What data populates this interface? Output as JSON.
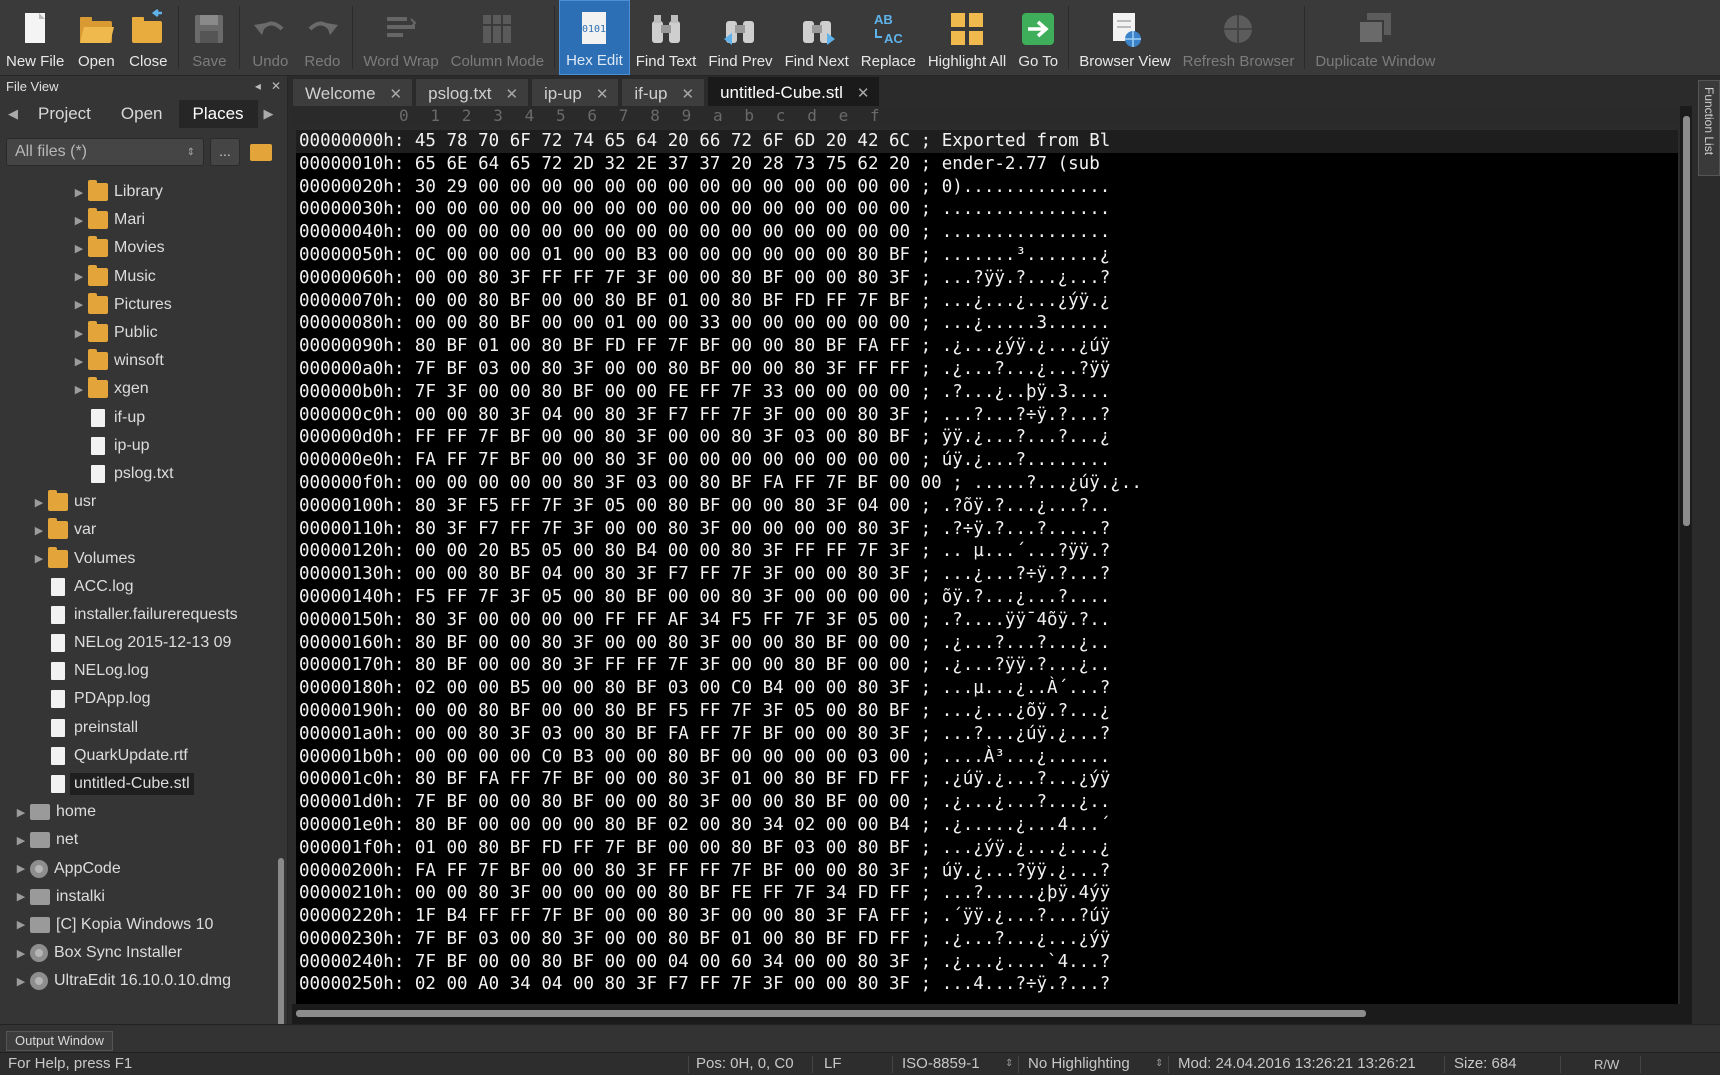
{
  "toolbar": {
    "buttons": [
      {
        "label": "New File",
        "icon": "new-file-icon",
        "enabled": true
      },
      {
        "label": "Open",
        "icon": "open-folder-icon",
        "enabled": true
      },
      {
        "label": "Close",
        "icon": "close-folder-icon",
        "enabled": true
      },
      {
        "label": "Save",
        "icon": "save-icon",
        "enabled": false
      },
      {
        "label": "Undo",
        "icon": "undo-icon",
        "enabled": false
      },
      {
        "label": "Redo",
        "icon": "redo-icon",
        "enabled": false
      },
      {
        "label": "Word Wrap",
        "icon": "word-wrap-icon",
        "enabled": false
      },
      {
        "label": "Column Mode",
        "icon": "column-mode-icon",
        "enabled": false
      },
      {
        "label": "Hex Edit",
        "icon": "hex-edit-icon",
        "enabled": true,
        "active": true,
        "icon_text": "0101"
      },
      {
        "label": "Find Text",
        "icon": "binoculars-icon",
        "enabled": true
      },
      {
        "label": "Find Prev",
        "icon": "find-prev-icon",
        "enabled": true
      },
      {
        "label": "Find Next",
        "icon": "find-next-icon",
        "enabled": true
      },
      {
        "label": "Replace",
        "icon": "replace-icon",
        "enabled": true,
        "icon_text_top": "AB",
        "icon_text_bottom": "AC"
      },
      {
        "label": "Highlight All",
        "icon": "highlight-all-icon",
        "enabled": true
      },
      {
        "label": "Go To",
        "icon": "go-to-icon",
        "enabled": true
      },
      {
        "label": "Browser View",
        "icon": "browser-view-icon",
        "enabled": true
      },
      {
        "label": "Refresh Browser",
        "icon": "refresh-browser-icon",
        "enabled": false
      },
      {
        "label": "Duplicate Window",
        "icon": "duplicate-window-icon",
        "enabled": false
      }
    ]
  },
  "file_view": {
    "title": "File View",
    "tabs": [
      "Project",
      "Open",
      "Places"
    ],
    "selected_tab": "Places",
    "filter": "All files (*)",
    "more_label": "...",
    "tree": [
      {
        "label": "Library",
        "type": "folder",
        "depth": 2,
        "expandable": true
      },
      {
        "label": "Mari",
        "type": "folder",
        "depth": 2,
        "expandable": true
      },
      {
        "label": "Movies",
        "type": "folder",
        "depth": 2,
        "expandable": true
      },
      {
        "label": "Music",
        "type": "folder",
        "depth": 2,
        "expandable": true
      },
      {
        "label": "Pictures",
        "type": "folder",
        "depth": 2,
        "expandable": true
      },
      {
        "label": "Public",
        "type": "folder",
        "depth": 2,
        "expandable": true
      },
      {
        "label": "winsoft",
        "type": "folder",
        "depth": 2,
        "expandable": true
      },
      {
        "label": "xgen",
        "type": "folder",
        "depth": 2,
        "expandable": true
      },
      {
        "label": "if-up",
        "type": "file",
        "depth": 2,
        "expandable": false
      },
      {
        "label": "ip-up",
        "type": "file",
        "depth": 2,
        "expandable": false
      },
      {
        "label": "pslog.txt",
        "type": "file",
        "depth": 2,
        "expandable": false
      },
      {
        "label": "usr",
        "type": "folder",
        "depth": 1,
        "expandable": true
      },
      {
        "label": "var",
        "type": "folder",
        "depth": 1,
        "expandable": true
      },
      {
        "label": "Volumes",
        "type": "folder",
        "depth": 1,
        "expandable": true
      },
      {
        "label": "ACC.log",
        "type": "file",
        "depth": 1,
        "expandable": false
      },
      {
        "label": "installer.failurerequests",
        "type": "file",
        "depth": 1,
        "expandable": false
      },
      {
        "label": "NELog 2015-12-13 09",
        "type": "file",
        "depth": 1,
        "expandable": false
      },
      {
        "label": "NELog.log",
        "type": "file",
        "depth": 1,
        "expandable": false
      },
      {
        "label": "PDApp.log",
        "type": "file",
        "depth": 1,
        "expandable": false
      },
      {
        "label": "preinstall",
        "type": "file",
        "depth": 1,
        "expandable": false
      },
      {
        "label": "QuarkUpdate.rtf",
        "type": "file",
        "depth": 1,
        "expandable": false
      },
      {
        "label": "untitled-Cube.stl",
        "type": "file",
        "depth": 1,
        "expandable": false,
        "selected": true
      },
      {
        "label": "home",
        "type": "drive",
        "depth": 0,
        "expandable": true
      },
      {
        "label": "net",
        "type": "drive",
        "depth": 0,
        "expandable": true
      },
      {
        "label": "AppCode",
        "type": "disc",
        "depth": 0,
        "expandable": true
      },
      {
        "label": "instalki",
        "type": "drive",
        "depth": 0,
        "expandable": true
      },
      {
        "label": "[C] Kopia Windows 10",
        "type": "drive",
        "depth": 0,
        "expandable": true
      },
      {
        "label": "Box Sync Installer",
        "type": "disc",
        "depth": 0,
        "expandable": true
      },
      {
        "label": "UltraEdit 16.10.0.10.dmg",
        "type": "disc",
        "depth": 0,
        "expandable": true
      }
    ]
  },
  "editor": {
    "tabs": [
      {
        "label": "Welcome",
        "active": false
      },
      {
        "label": "pslog.txt",
        "active": false
      },
      {
        "label": "ip-up",
        "active": false
      },
      {
        "label": "if-up",
        "active": false
      },
      {
        "label": "untitled-Cube.stl",
        "active": true
      }
    ],
    "column_headers": [
      "0",
      "1",
      "2",
      "3",
      "4",
      "5",
      "6",
      "7",
      "8",
      "9",
      "a",
      "b",
      "c",
      "d",
      "e",
      "f"
    ],
    "hex_rows": [
      "00000000h: 45 78 70 6F 72 74 65 64 20 66 72 6F 6D 20 42 6C ; Exported from Bl",
      "00000010h: 65 6E 64 65 72 2D 32 2E 37 37 20 28 73 75 62 20 ; ender-2.77 (sub ",
      "00000020h: 30 29 00 00 00 00 00 00 00 00 00 00 00 00 00 00 ; 0)..............",
      "00000030h: 00 00 00 00 00 00 00 00 00 00 00 00 00 00 00 00 ; ................",
      "00000040h: 00 00 00 00 00 00 00 00 00 00 00 00 00 00 00 00 ; ................",
      "00000050h: 0C 00 00 00 01 00 00 B3 00 00 00 00 00 00 80 BF ; .......³.......¿",
      "00000060h: 00 00 80 3F FF FF 7F 3F 00 00 80 BF 00 00 80 3F ; ...?ÿÿ.?...¿...?",
      "00000070h: 00 00 80 BF 00 00 80 BF 01 00 80 BF FD FF 7F BF ; ...¿...¿...¿ýÿ.¿",
      "00000080h: 00 00 80 BF 00 00 01 00 00 33 00 00 00 00 00 00 ; ...¿.....3......",
      "00000090h: 80 BF 01 00 80 BF FD FF 7F BF 00 00 80 BF FA FF ; .¿...¿ýÿ.¿...¿úÿ",
      "000000a0h: 7F BF 03 00 80 3F 00 00 80 BF 00 00 80 3F FF FF ; .¿...?...¿...?ÿÿ",
      "000000b0h: 7F 3F 00 00 80 BF 00 00 FE FF 7F 33 00 00 00 00 ; .?...¿..þÿ.3....",
      "000000c0h: 00 00 80 3F 04 00 80 3F F7 FF 7F 3F 00 00 80 3F ; ...?...?÷ÿ.?...?",
      "000000d0h: FF FF 7F BF 00 00 80 3F 00 00 80 3F 03 00 80 BF ; ÿÿ.¿...?...?...¿",
      "000000e0h: FA FF 7F BF 00 00 80 3F 00 00 00 00 00 00 00 00 ; úÿ.¿...?........",
      "000000f0h: 00 00 00 00 00 80 3F 03 00 80 BF FA FF 7F BF 00 00 ; .....?...¿úÿ.¿..",
      "00000100h: 80 3F F5 FF 7F 3F 05 00 80 BF 00 00 80 3F 04 00 ; .?õÿ.?...¿...?..",
      "00000110h: 80 3F F7 FF 7F 3F 00 00 80 3F 00 00 00 00 80 3F ; .?÷ÿ.?...?.....?",
      "00000120h: 00 00 20 B5 05 00 80 B4 00 00 80 3F FF FF 7F 3F ; .. µ...´...?ÿÿ.?",
      "00000130h: 00 00 80 BF 04 00 80 3F F7 FF 7F 3F 00 00 80 3F ; ...¿...?÷ÿ.?...?",
      "00000140h: F5 FF 7F 3F 05 00 80 BF 00 00 80 3F 00 00 00 00 ; õÿ.?...¿...?....",
      "00000150h: 80 3F 00 00 00 00 FF FF AF 34 F5 FF 7F 3F 05 00 ; .?....ÿÿ¯4õÿ.?..",
      "00000160h: 80 BF 00 00 80 3F 00 00 80 3F 00 00 80 BF 00 00 ; .¿...?...?...¿..",
      "00000170h: 80 BF 00 00 80 3F FF FF 7F 3F 00 00 80 BF 00 00 ; .¿...?ÿÿ.?...¿..",
      "00000180h: 02 00 00 B5 00 00 80 BF 03 00 C0 B4 00 00 80 3F ; ...µ...¿..À´...?",
      "00000190h: 00 00 80 BF 00 00 80 BF F5 FF 7F 3F 05 00 80 BF ; ...¿...¿õÿ.?...¿",
      "000001a0h: 00 00 80 3F 03 00 80 BF FA FF 7F BF 00 00 80 3F ; ...?...¿úÿ.¿...?",
      "000001b0h: 00 00 00 00 C0 B3 00 00 80 BF 00 00 00 00 03 00 ; ....À³...¿......",
      "000001c0h: 80 BF FA FF 7F BF 00 00 80 3F 01 00 80 BF FD FF ; .¿úÿ.¿...?...¿ýÿ",
      "000001d0h: 7F BF 00 00 80 BF 00 00 80 3F 00 00 80 BF 00 00 ; .¿...¿...?...¿..",
      "000001e0h: 80 BF 00 00 00 00 80 BF 02 00 80 34 02 00 00 B4 ; .¿.....¿...4...´",
      "000001f0h: 01 00 80 BF FD FF 7F BF 00 00 80 BF 03 00 80 BF ; ...¿ýÿ.¿...¿...¿",
      "00000200h: FA FF 7F BF 00 00 80 3F FF FF 7F BF 00 00 80 3F ; úÿ.¿...?ÿÿ.¿...?",
      "00000210h: 00 00 80 3F 00 00 00 00 80 BF FE FF 7F 34 FD FF ; ...?.....¿þÿ.4ýÿ",
      "00000220h: 1F B4 FF FF 7F BF 00 00 80 3F 00 00 80 3F FA FF ; .´ÿÿ.¿...?...?úÿ",
      "00000230h: 7F BF 03 00 80 3F 00 00 80 BF 01 00 80 BF FD FF ; .¿...?...¿...¿ýÿ",
      "00000240h: 7F BF 00 00 80 BF 00 00 04 00 60 34 00 00 80 3F ; .¿...¿....`4...?",
      "00000250h: 02 00 A0 34 04 00 80 3F F7 FF 7F 3F 00 00 80 3F ; ...4...?÷ÿ.?...?"
    ]
  },
  "function_list": {
    "label": "Function List"
  },
  "output": {
    "label": "Output Window"
  },
  "status": {
    "help": "For Help, press F1",
    "position": "Pos: 0H, 0, C0",
    "line_ending": "LF",
    "encoding": "ISO-8859-1",
    "highlighting": "No Highlighting",
    "modified": "Mod: 24.04.2016 13:26:21 13:26:21",
    "size": "Size: 684",
    "mode": "R/W"
  }
}
